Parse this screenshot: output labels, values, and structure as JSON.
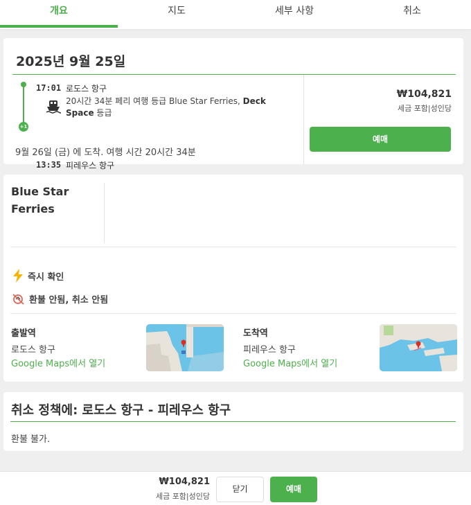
{
  "tabs": [
    {
      "label": "개요",
      "active": true
    },
    {
      "label": "지도",
      "active": false
    },
    {
      "label": "세부 사항",
      "active": false
    },
    {
      "label": "취소",
      "active": false
    }
  ],
  "trip": {
    "date": "2025년 9월 25일",
    "departure": {
      "time": "17:01",
      "port": "로도스 항구"
    },
    "description_pre": "20시간 34분 페리 여행 등급 Blue Star Ferries,",
    "class_name": "Deck Space",
    "description_post": "등급",
    "arrival": {
      "time": "13:35",
      "port": "피레우스 항구",
      "day_badge": "+1"
    },
    "arrival_note": "9월 26일 (금) 에 도착. 여행 시간 20시간 34분",
    "price": "₩104,821",
    "price_note": "세금 포함|성인당",
    "book_label": "예매"
  },
  "operator": {
    "name": "Blue Star Ferries",
    "features": [
      {
        "icon": "lightning-icon",
        "label": "즉시 확인"
      },
      {
        "icon": "no-refund-icon",
        "label": "환불 안됨, 취소 안됨"
      }
    ],
    "departure_station": {
      "title": "출발역",
      "name": "로도스 항구",
      "link": "Google Maps에서 열기"
    },
    "arrival_station": {
      "title": "도착역",
      "name": "피레우스 항구",
      "link": "Google Maps에서 열기"
    }
  },
  "cancellation": {
    "title": "취소 정책에: 로도스 항구 - 피레우스 항구",
    "text": "환불 불가."
  },
  "bottom_bar": {
    "price": "₩104,821",
    "price_note": "세금 포함|성인당",
    "close_label": "닫기",
    "book_label": "예매"
  },
  "colors": {
    "accent": "#4cb04c",
    "background": "#efefef",
    "map_water": "#6cc3e8"
  }
}
